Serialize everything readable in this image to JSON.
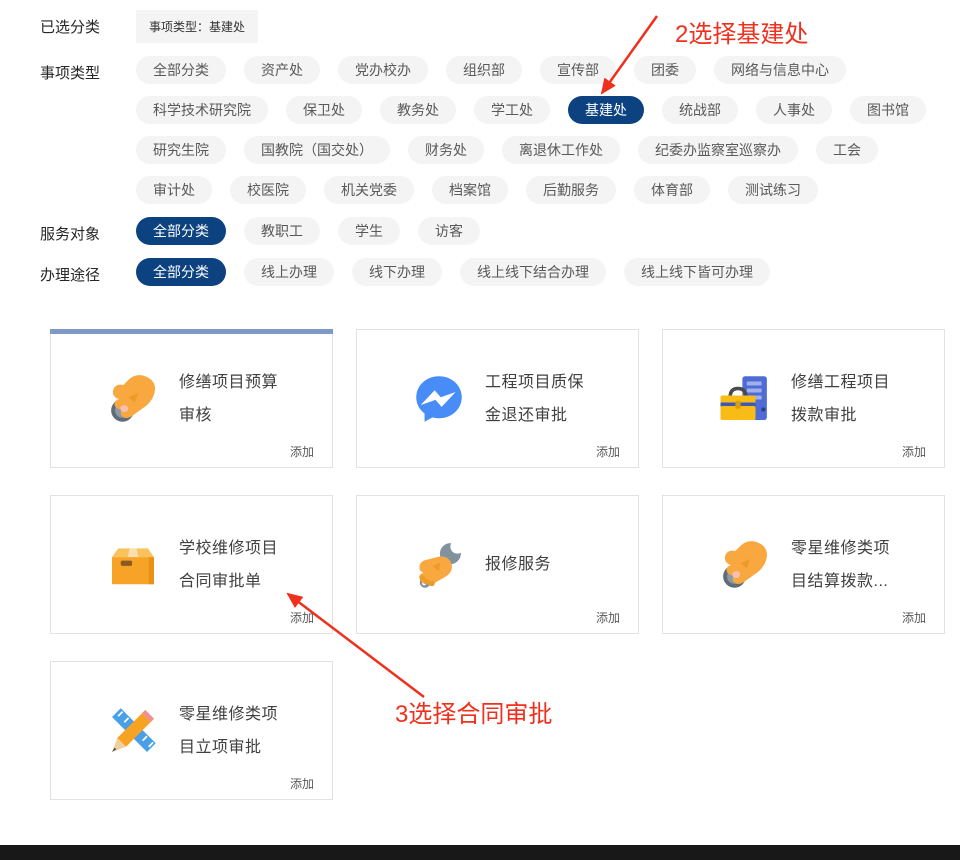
{
  "filters": {
    "selected": {
      "label": "已选分类",
      "tag": "事项类型：基建处"
    },
    "item_type": {
      "label": "事项类型",
      "chips": [
        "全部分类",
        "资产处",
        "党办校办",
        "组织部",
        "宣传部",
        "团委",
        "网络与信息中心",
        "科学技术研究院",
        "保卫处",
        "教务处",
        "学工处",
        "基建处",
        "统战部",
        "人事处",
        "图书馆",
        "研究生院",
        "国教院（国交处）",
        "财务处",
        "离退休工作处",
        "纪委办监察室巡察办",
        "工会",
        "审计处",
        "校医院",
        "机关党委",
        "档案馆",
        "后勤服务",
        "体育部",
        "测试练习"
      ],
      "selected_chip": "基建处"
    },
    "service_target": {
      "label": "服务对象",
      "chips": [
        "全部分类",
        "教职工",
        "学生",
        "访客"
      ],
      "selected_chip": "全部分类"
    },
    "channel": {
      "label": "办理途径",
      "chips": [
        "全部分类",
        "线上办理",
        "线下办理",
        "线上线下结合办理",
        "线上线下皆可办理"
      ],
      "selected_chip": "全部分类"
    }
  },
  "cards": {
    "add_label": "添加",
    "items": [
      {
        "icon": "coin-hand",
        "lines": [
          "修缮项目预算",
          "审核"
        ],
        "highlighted": true
      },
      {
        "icon": "messenger",
        "lines": [
          "工程项目质保",
          "金退还审批"
        ]
      },
      {
        "icon": "toolbox",
        "lines": [
          "修缮工程项目",
          "拨款审批"
        ]
      },
      {
        "icon": "package-box",
        "lines": [
          "学校维修项目",
          "合同审批单"
        ]
      },
      {
        "icon": "wrench-hand",
        "lines": [
          "报修服务",
          ""
        ]
      },
      {
        "icon": "coin-hand",
        "lines": [
          "零星维修类项",
          "目结算拨款..."
        ]
      },
      {
        "icon": "pencil-ruler",
        "lines": [
          "零星维修类项",
          "目立项审批"
        ]
      }
    ]
  },
  "annotations": [
    {
      "text": "2选择基建处",
      "color": "#f0301e"
    },
    {
      "text": "3选择合同审批",
      "color": "#f0301e"
    }
  ],
  "colors": {
    "selected_chip_bg": "#0c4280",
    "chip_bg": "#f4f4f5",
    "card_top_bar": "#7d9ac7",
    "annotation_red": "#f0301e"
  }
}
